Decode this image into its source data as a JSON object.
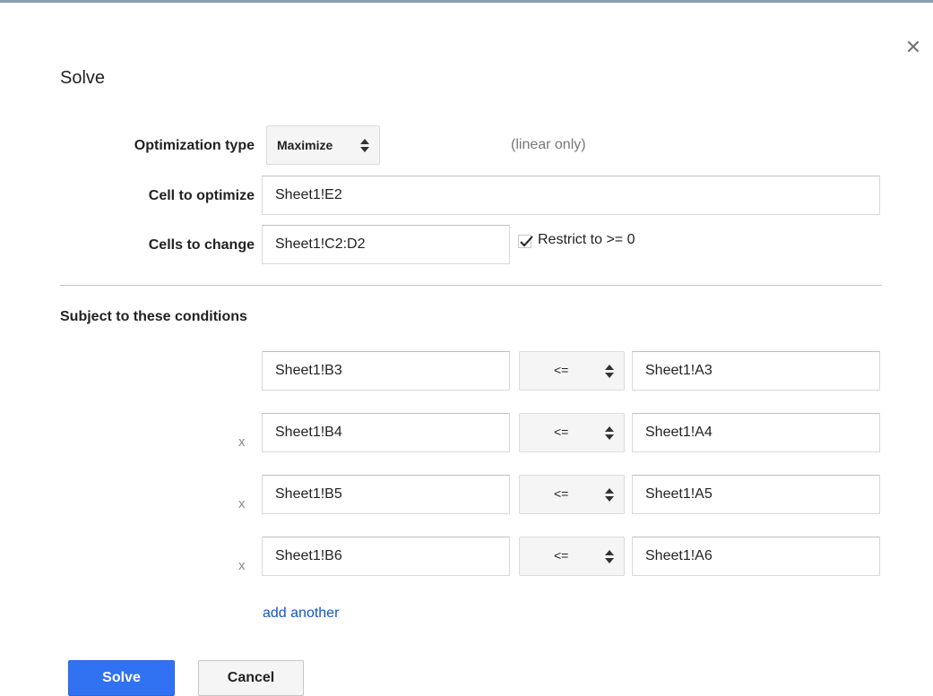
{
  "dialog": {
    "title": "Solve",
    "close_icon": "close-icon",
    "close_glyph": "✕"
  },
  "form": {
    "optimization_type_label": "Optimization type",
    "optimization_type_value": "Maximize",
    "linear_hint": "(linear only)",
    "cell_to_optimize_label": "Cell to optimize",
    "cell_to_optimize_value": "Sheet1!E2",
    "cells_to_change_label": "Cells to change",
    "cells_to_change_value": "Sheet1!C2:D2",
    "restrict_label": "Restrict to >= 0",
    "restrict_checked": true
  },
  "conditions": {
    "title": "Subject to these conditions",
    "remove_glyph": "x",
    "rows": [
      {
        "left": "Sheet1!B3",
        "op": "<=",
        "right": "Sheet1!A3",
        "removable": false
      },
      {
        "left": "Sheet1!B4",
        "op": "<=",
        "right": "Sheet1!A4",
        "removable": true
      },
      {
        "left": "Sheet1!B5",
        "op": "<=",
        "right": "Sheet1!A5",
        "removable": true
      },
      {
        "left": "Sheet1!B6",
        "op": "<=",
        "right": "Sheet1!A6",
        "removable": true
      }
    ],
    "add_another_label": "add another"
  },
  "buttons": {
    "solve_label": "Solve",
    "cancel_label": "Cancel"
  },
  "colors": {
    "primary": "#3072f2",
    "link": "#1155cc",
    "top_border": "#8a9eb3"
  }
}
